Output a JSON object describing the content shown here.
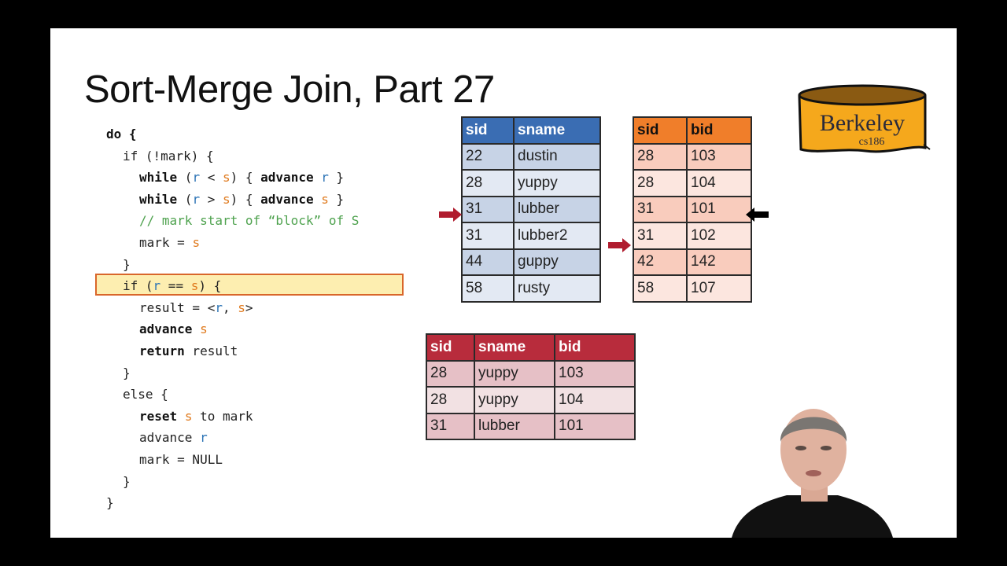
{
  "slide": {
    "title": "Sort-Merge Join, Part 27",
    "code_lines": [
      {
        "indent": 0,
        "tokens": [
          {
            "t": "do {",
            "c": "kw"
          }
        ]
      },
      {
        "indent": 1,
        "tokens": [
          {
            "t": "if (!mark) {",
            "c": ""
          }
        ]
      },
      {
        "indent": 2,
        "tokens": [
          {
            "t": "while",
            "c": "kw"
          },
          {
            "t": " (",
            "c": ""
          },
          {
            "t": "r",
            "c": "r"
          },
          {
            "t": " < ",
            "c": ""
          },
          {
            "t": "s",
            "c": "s"
          },
          {
            "t": ") { ",
            "c": ""
          },
          {
            "t": "advance",
            "c": "kw"
          },
          {
            "t": " ",
            "c": ""
          },
          {
            "t": "r",
            "c": "r"
          },
          {
            "t": " }",
            "c": ""
          }
        ]
      },
      {
        "indent": 2,
        "tokens": [
          {
            "t": "while",
            "c": "kw"
          },
          {
            "t": " (",
            "c": ""
          },
          {
            "t": "r",
            "c": "r"
          },
          {
            "t": " > ",
            "c": ""
          },
          {
            "t": "s",
            "c": "s"
          },
          {
            "t": ") { ",
            "c": ""
          },
          {
            "t": "advance",
            "c": "kw"
          },
          {
            "t": " ",
            "c": ""
          },
          {
            "t": "s",
            "c": "s"
          },
          {
            "t": " }",
            "c": ""
          }
        ]
      },
      {
        "indent": 2,
        "tokens": [
          {
            "t": "// mark start of “block” of S",
            "c": "cm"
          }
        ]
      },
      {
        "indent": 2,
        "tokens": [
          {
            "t": "mark = ",
            "c": ""
          },
          {
            "t": "s",
            "c": "s"
          }
        ]
      },
      {
        "indent": 1,
        "tokens": [
          {
            "t": "}",
            "c": ""
          }
        ]
      },
      {
        "indent": 1,
        "tokens": [
          {
            "t": "if (",
            "c": ""
          },
          {
            "t": "r",
            "c": "r"
          },
          {
            "t": " == ",
            "c": ""
          },
          {
            "t": "s",
            "c": "s"
          },
          {
            "t": ") {",
            "c": ""
          }
        ],
        "highlighted": true
      },
      {
        "indent": 2,
        "tokens": [
          {
            "t": "result = <",
            "c": ""
          },
          {
            "t": "r",
            "c": "r"
          },
          {
            "t": ", ",
            "c": ""
          },
          {
            "t": "s",
            "c": "s"
          },
          {
            "t": ">",
            "c": ""
          }
        ]
      },
      {
        "indent": 2,
        "tokens": [
          {
            "t": "advance",
            "c": "kw"
          },
          {
            "t": " ",
            "c": ""
          },
          {
            "t": "s",
            "c": "s"
          }
        ]
      },
      {
        "indent": 2,
        "tokens": [
          {
            "t": "return",
            "c": "kw"
          },
          {
            "t": " result",
            "c": ""
          }
        ]
      },
      {
        "indent": 1,
        "tokens": [
          {
            "t": "}",
            "c": ""
          }
        ]
      },
      {
        "indent": 1,
        "tokens": [
          {
            "t": "else {",
            "c": ""
          }
        ]
      },
      {
        "indent": 2,
        "tokens": [
          {
            "t": "reset",
            "c": "kw"
          },
          {
            "t": " ",
            "c": ""
          },
          {
            "t": "s",
            "c": "s"
          },
          {
            "t": " to mark",
            "c": ""
          }
        ]
      },
      {
        "indent": 2,
        "tokens": [
          {
            "t": "advance ",
            "c": ""
          },
          {
            "t": "r",
            "c": "r"
          }
        ]
      },
      {
        "indent": 2,
        "tokens": [
          {
            "t": "mark = NULL",
            "c": ""
          }
        ]
      },
      {
        "indent": 1,
        "tokens": [
          {
            "t": "}",
            "c": ""
          }
        ]
      },
      {
        "indent": 0,
        "tokens": [
          {
            "t": "}",
            "c": ""
          }
        ]
      }
    ],
    "sailors_table": {
      "headers": [
        "sid",
        "sname"
      ],
      "rows": [
        [
          "22",
          "dustin"
        ],
        [
          "28",
          "yuppy"
        ],
        [
          "31",
          "lubber"
        ],
        [
          "31",
          "lubber2"
        ],
        [
          "44",
          "guppy"
        ],
        [
          "58",
          "rusty"
        ]
      ],
      "r_pointer_row": 2
    },
    "reserves_table": {
      "headers": [
        "sid",
        "bid"
      ],
      "rows": [
        [
          "28",
          "103"
        ],
        [
          "28",
          "104"
        ],
        [
          "31",
          "101"
        ],
        [
          "31",
          "102"
        ],
        [
          "42",
          "142"
        ],
        [
          "58",
          "107"
        ]
      ],
      "s_pointer_row": 3,
      "mark_pointer_row": 2
    },
    "result_table": {
      "headers": [
        "sid",
        "sname",
        "bid"
      ],
      "rows": [
        [
          "28",
          "yuppy",
          "103"
        ],
        [
          "28",
          "yuppy",
          "104"
        ],
        [
          "31",
          "lubber",
          "101"
        ]
      ]
    },
    "logo": {
      "main": "Berkeley",
      "sub": "cs186"
    },
    "colors": {
      "pointer_arrow": "#b01c2e",
      "mark_arrow": "#000000",
      "highlight_fill": "#fdeeb0",
      "highlight_border": "#d9662a"
    }
  }
}
